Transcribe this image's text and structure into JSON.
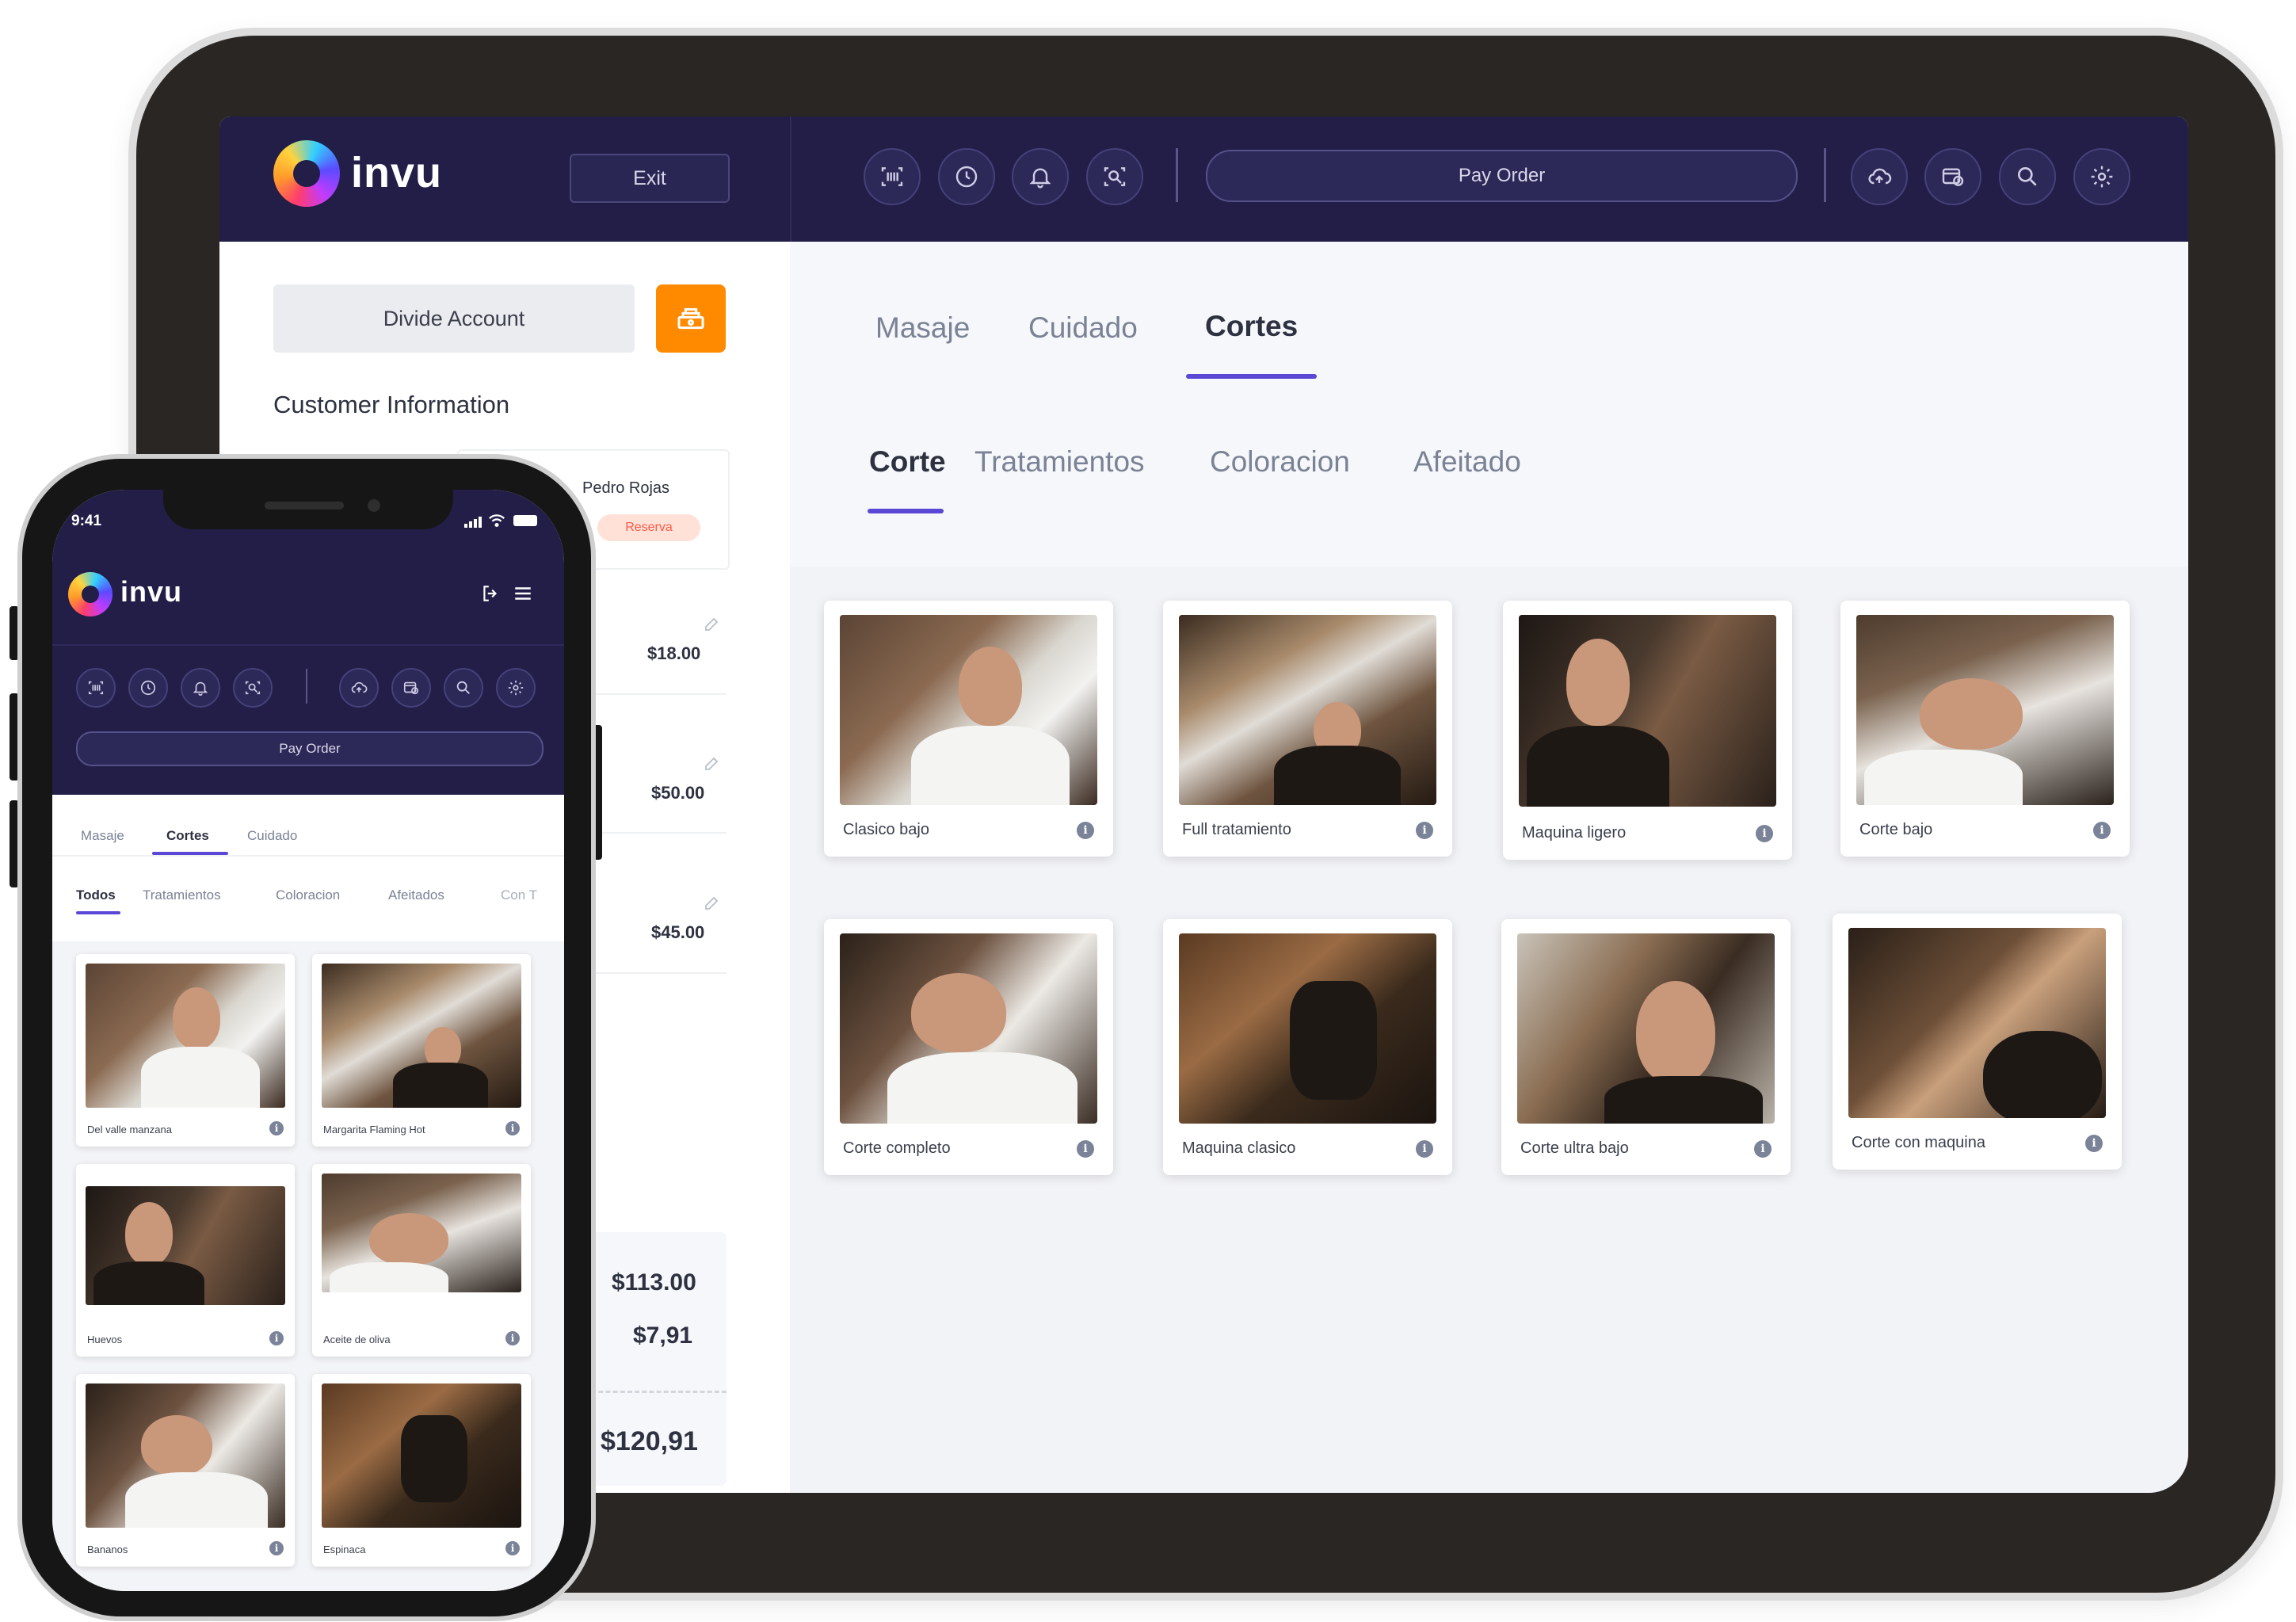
{
  "brand": {
    "name": "invu"
  },
  "tablet": {
    "header": {
      "exit_label": "Exit",
      "pay_order_label": "Pay Order",
      "left_icons": [
        "barcode-scan-icon",
        "clock-icon",
        "bell-icon",
        "face-scan-icon"
      ],
      "right_icons": [
        "cloud-sync-icon",
        "calendar-clock-icon",
        "search-icon",
        "gear-icon"
      ]
    },
    "left_panel": {
      "divide_account_label": "Divide Account",
      "customer_info_title": "Customer Information",
      "customer_name": "Pedro Rojas",
      "customer_badge": "Reserva",
      "line_prices": [
        "$18.00",
        "$50.00",
        "$45.00"
      ],
      "subtotal": "$113.00",
      "tax": "$7,91",
      "total": "$120,91"
    },
    "category_tabs": [
      {
        "label": "Masaje",
        "active": false
      },
      {
        "label": "Cuidado",
        "active": false
      },
      {
        "label": "Cortes",
        "active": true
      }
    ],
    "sub_tabs": [
      {
        "label": "Corte",
        "active": true
      },
      {
        "label": "Tratamientos",
        "active": false
      },
      {
        "label": "Coloracion",
        "active": false
      },
      {
        "label": "Afeitado",
        "active": false
      }
    ],
    "products": [
      {
        "name": "Clasico bajo"
      },
      {
        "name": "Full tratamiento"
      },
      {
        "name": "Maquina ligero"
      },
      {
        "name": "Corte bajo"
      },
      {
        "name": "Corte completo"
      },
      {
        "name": "Maquina clasico"
      },
      {
        "name": "Corte ultra bajo"
      },
      {
        "name": "Corte con maquina"
      }
    ]
  },
  "phone": {
    "status_time": "9:41",
    "pay_order_label": "Pay Order",
    "category_tabs": [
      {
        "label": "Masaje",
        "active": false
      },
      {
        "label": "Cortes",
        "active": true
      },
      {
        "label": "Cuidado",
        "active": false
      }
    ],
    "sub_tabs": [
      {
        "label": "Todos",
        "active": true
      },
      {
        "label": "Tratamientos",
        "active": false
      },
      {
        "label": "Coloracion",
        "active": false
      },
      {
        "label": "Afeitados",
        "active": false
      },
      {
        "label": "Con T",
        "active": false
      }
    ],
    "products": [
      {
        "name": "Del valle manzana"
      },
      {
        "name": "Margarita Flaming Hot"
      },
      {
        "name": "Huevos"
      },
      {
        "name": "Aceite de oliva"
      },
      {
        "name": "Bananos"
      },
      {
        "name": "Espinaca"
      }
    ]
  },
  "colors": {
    "header_bg": "#221e47",
    "accent_purple": "#5b47d6",
    "accent_orange": "#ff8a00",
    "badge_red": "#ff5a45"
  }
}
